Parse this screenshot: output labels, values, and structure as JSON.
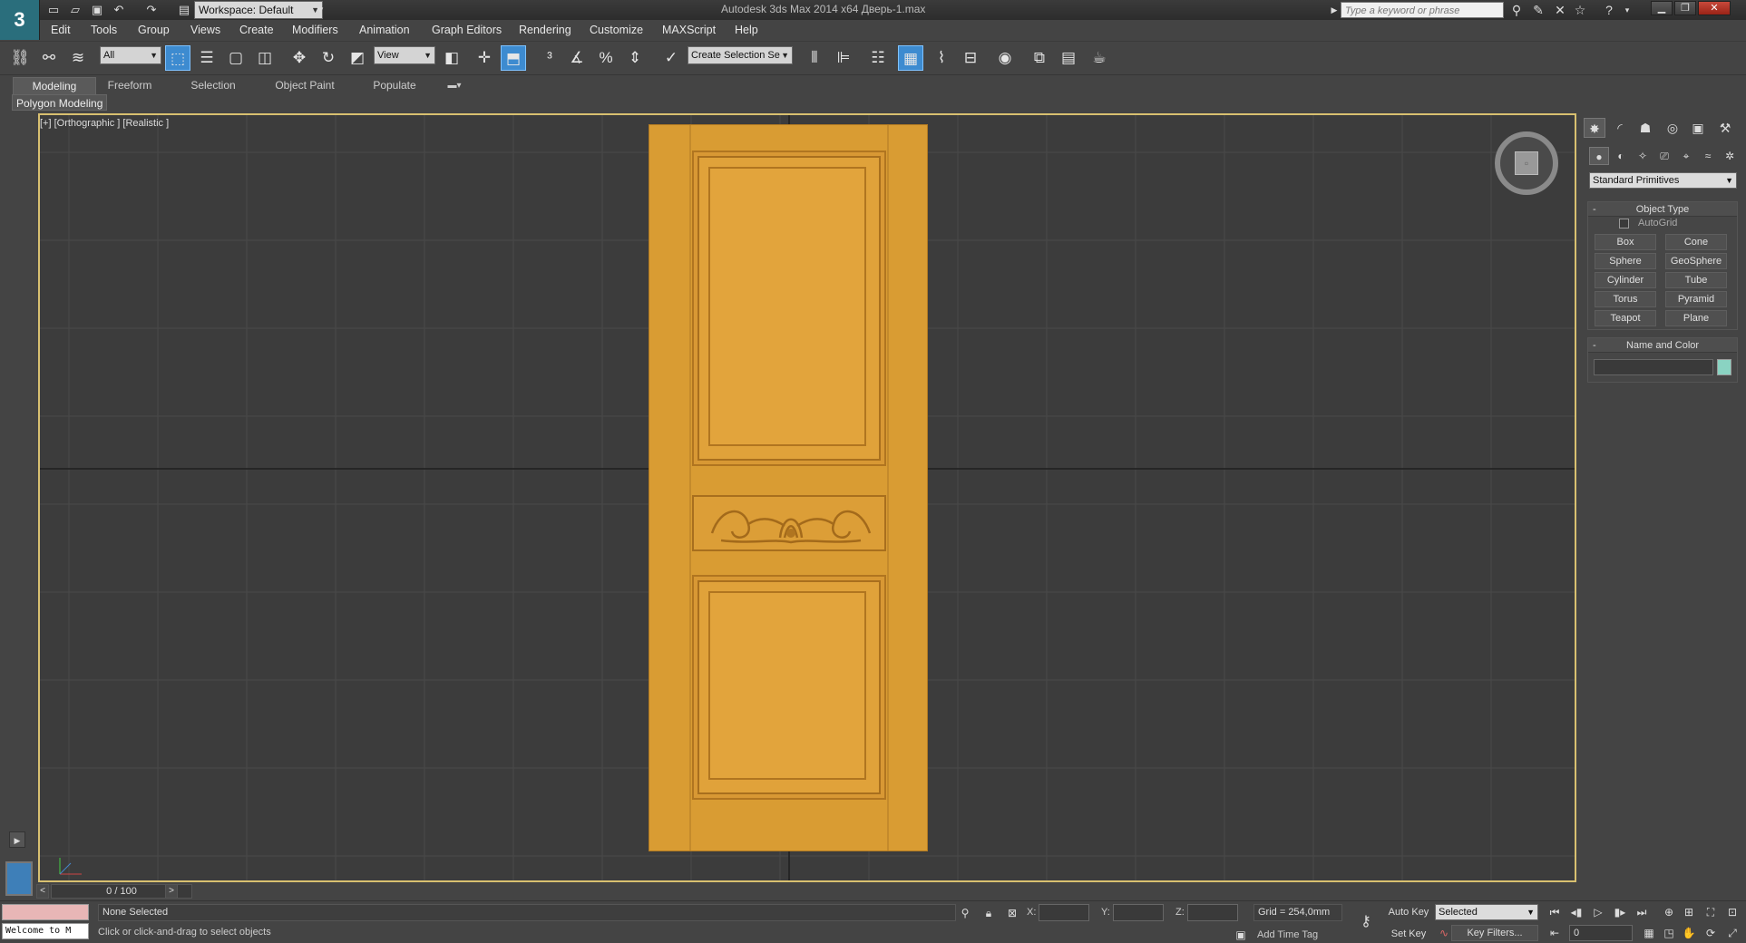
{
  "window": {
    "title": "Autodesk 3ds Max  2014 x64     Дверь-1.max",
    "workspace": "Workspace: Default",
    "search_placeholder": "Type a keyword or phrase"
  },
  "menu": [
    "Edit",
    "Tools",
    "Group",
    "Views",
    "Create",
    "Modifiers",
    "Animation",
    "Graph Editors",
    "Rendering",
    "Customize",
    "MAXScript",
    "Help"
  ],
  "toolbar": {
    "selection_filter": "All",
    "ref_coord": "View",
    "named_selection": "Create Selection Se"
  },
  "ribbon": {
    "tabs": [
      "Modeling",
      "Freeform",
      "Selection",
      "Object Paint",
      "Populate"
    ],
    "panel_label": "Polygon Modeling"
  },
  "viewport": {
    "label": "[+] [Orthographic ] [Realistic ]",
    "border_color": "#d8c070",
    "door_color": "#d99c33"
  },
  "command_panel": {
    "primitives_dropdown": "Standard Primitives",
    "object_type_title": "Object Type",
    "autogrid_label": "AutoGrid",
    "buttons": [
      "Box",
      "Cone",
      "Sphere",
      "GeoSphere",
      "Cylinder",
      "Tube",
      "Torus",
      "Pyramid",
      "Teapot",
      "Plane"
    ],
    "name_color_title": "Name and Color",
    "swatch_color": "#8ad3c2"
  },
  "timeline": {
    "position": "0 / 100",
    "prev": "<",
    "next": ">"
  },
  "status": {
    "maxscript_text": "Welcome to M",
    "selection": "None Selected",
    "prompt": "Click or click-and-drag to select objects",
    "x_label": "X:",
    "y_label": "Y:",
    "z_label": "Z:",
    "grid": "Grid = 254,0mm",
    "add_time_tag": "Add Time Tag",
    "auto_key": "Auto Key",
    "set_key": "Set Key",
    "selected_dropdown": "Selected",
    "key_filters": "Key Filters...",
    "frame": "0"
  }
}
